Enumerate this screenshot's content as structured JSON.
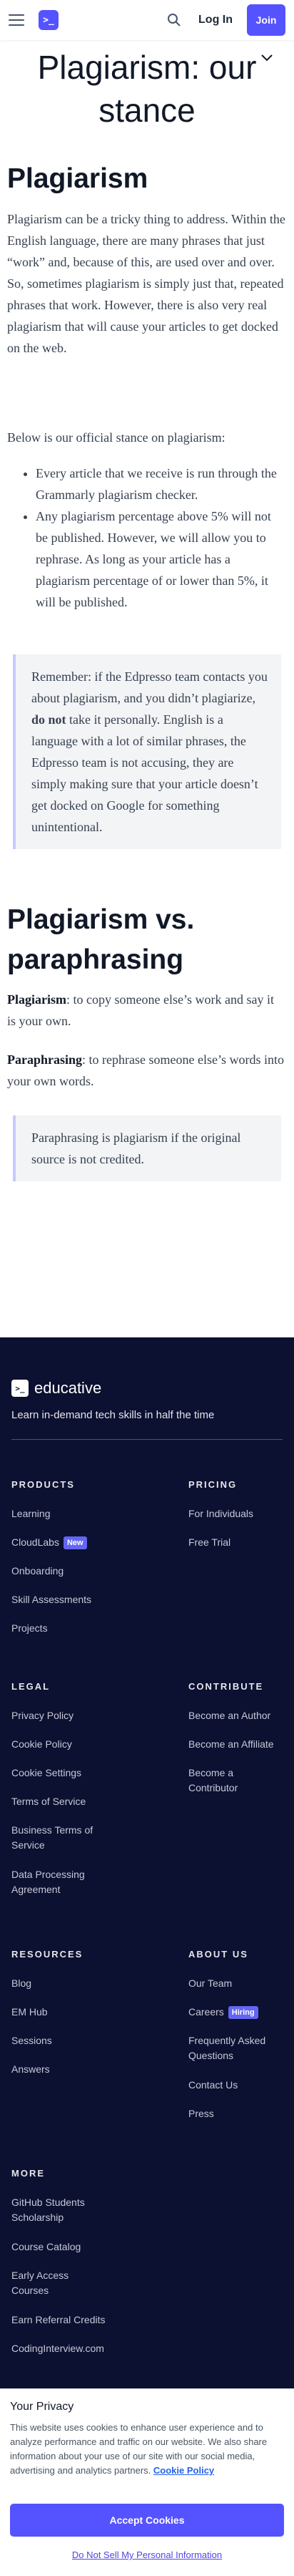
{
  "nav": {
    "logo_mark": ">_",
    "login_label": "Log In",
    "join_label": "Join"
  },
  "article": {
    "title": "Plagiarism: our stance",
    "section1_heading": "Plagiarism",
    "intro": "Plagiarism can be a tricky thing to address. Within the English language, there are many phrases that just “work” and, because of this, are used over and over. So, sometimes plagiarism is simply just that, repeated phrases that work. However, there is also very real plagiarism that will cause your articles to get docked on the web.",
    "stance_lead": "Below is our official stance on plagiarism:",
    "bullets": [
      "Every article that we receive is run through the Grammarly plagiarism checker.",
      "Any plagiarism percentage above 5% will not be published. However, we will allow you to rephrase. As long as your article has a plagiarism percentage of or lower than 5%, it will be published."
    ],
    "quote1_part1": "Remember: if the Edpresso team contacts you about plagiarism, and you didn’t plagiarize, ",
    "quote1_bold": "do not",
    "quote1_part2": " take it personally. English is a language with a lot of similar phrases, the Edpresso team is not accusing, they are simply making sure that your article doesn’t get docked on Google for something unintentional.",
    "section2_heading": "Plagiarism vs. paraphrasing",
    "def1_term": "Plagiarism",
    "def1_text": ": to copy someone else’s work and say it is your own.",
    "def2_term": "Paraphrasing",
    "def2_text": ": to rephrase someone else’s words into your own words.",
    "quote2": "Paraphrasing is plagiarism if the original source is not credited."
  },
  "footer": {
    "logo_mark": ">_",
    "brand": "educative",
    "tagline": "Learn in-demand tech skills in half the time",
    "products": {
      "heading": "PRODUCTS",
      "items": [
        "Learning",
        "CloudLabs",
        "Onboarding",
        "Skill Assessments",
        "Projects"
      ],
      "new_badge": "New"
    },
    "pricing": {
      "heading": "PRICING",
      "items": [
        "For Individuals",
        "Free Trial"
      ]
    },
    "legal": {
      "heading": "LEGAL",
      "items": [
        "Privacy Policy",
        "Cookie Policy",
        "Cookie Settings",
        "Terms of Service",
        "Business Terms of Service",
        "Data Processing Agreement"
      ]
    },
    "contribute": {
      "heading": "CONTRIBUTE",
      "items": [
        "Become an Author",
        "Become an Affiliate",
        "Become a Contributor"
      ]
    },
    "resources": {
      "heading": "RESOURCES",
      "items": [
        "Blog",
        "EM Hub",
        "Sessions",
        "Answers"
      ]
    },
    "about": {
      "heading": "ABOUT US",
      "items": [
        "Our Team",
        "Careers",
        "Frequently Asked Questions",
        "Contact Us",
        "Press"
      ],
      "hiring_badge": "Hiring"
    },
    "more": {
      "heading": "MORE",
      "items": [
        "GitHub Students Scholarship",
        "Course Catalog",
        "Early Access Courses",
        "Earn Referral Credits",
        "CodingInterview.com"
      ]
    }
  },
  "cookie": {
    "title": "Your Privacy",
    "text": "This website uses cookies to enhance user experience and to analyze performance and traffic on our website. We also share information about your use of our site with our social media, advertising and analytics partners.",
    "policy_link": "Cookie Policy",
    "accept_label": "Accept Cookies",
    "do_not_sell": "Do Not Sell My Personal Information"
  },
  "colors": {
    "brand": "#5553ff",
    "footer_bg": "#0c1031",
    "badge": "#6366f1"
  }
}
